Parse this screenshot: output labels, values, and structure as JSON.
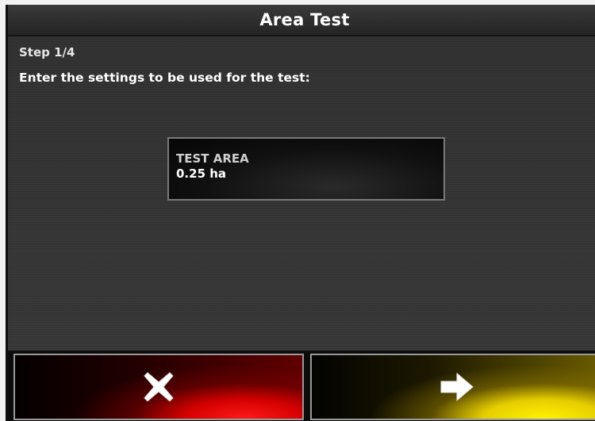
{
  "window": {
    "title": "Area Test"
  },
  "wizard": {
    "step": "Step 1/4",
    "instruction": "Enter the settings to be used for the test:"
  },
  "test_area": {
    "label": "TEST AREA",
    "value": "0.25 ha"
  },
  "footer": {
    "cancel_icon": "close-x-icon",
    "next_icon": "arrow-right-icon",
    "cancel_color": "#e00000",
    "next_color": "#f5e000"
  }
}
